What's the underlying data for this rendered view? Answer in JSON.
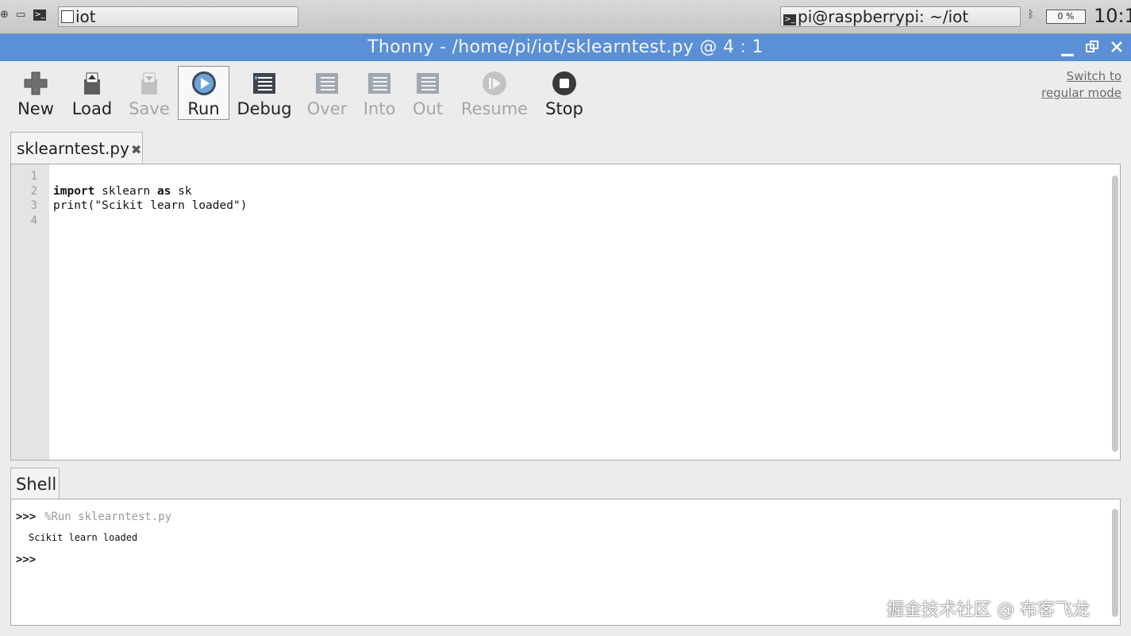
{
  "taskbar": {
    "icons": [
      "globe-icon",
      "file-manager-icon",
      "terminal-icon"
    ],
    "task_window_1": "iot",
    "task_window_2": "pi@raspberrypi: ~/iot",
    "battery_text": "0 %",
    "clock": "10:1"
  },
  "titlebar": {
    "title": "Thonny  -  /home/pi/iot/sklearntest.py  @  4 : 1",
    "controls": [
      "minimize-icon",
      "maximize-icon",
      "close-icon"
    ]
  },
  "toolbar": {
    "new": "New",
    "load": "Load",
    "save": "Save",
    "run": "Run",
    "debug": "Debug",
    "over": "Over",
    "into": "Into",
    "out": "Out",
    "resume": "Resume",
    "stop": "Stop",
    "switch_line1": "Switch to",
    "switch_line2": "regular mode"
  },
  "editor": {
    "tab_label": "sklearntest.py",
    "tab_close": "✖",
    "line_numbers": [
      "1",
      "2",
      "3",
      "4"
    ],
    "line2_kw1": "import",
    "line2_mid": " sklearn ",
    "line2_kw2": "as",
    "line2_end": " sk",
    "line3": "print(\"Scikit learn loaded\")"
  },
  "shell": {
    "tab_label": "Shell",
    "prompt": ">>>",
    "command": "%Run sklearntest.py",
    "output": "Scikit learn loaded",
    "prompt2": ">>>"
  },
  "watermark": "掘金技术社区 @ 布客飞龙",
  "colors": {
    "title_bar": "#5b8fd6",
    "toolbar_bg": "#ececec",
    "gutter": "#e4e4e4"
  }
}
